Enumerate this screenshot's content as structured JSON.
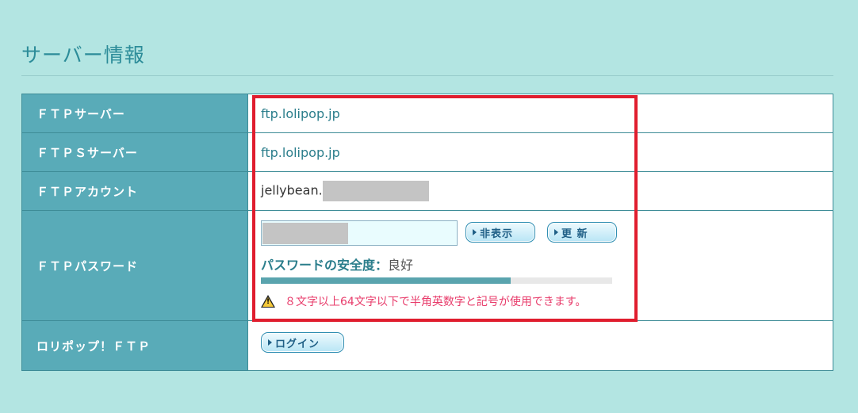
{
  "page": {
    "title": "サーバー情報"
  },
  "rows": {
    "ftp_server": {
      "label": "ＦＴＰサーバー",
      "value": "ftp.lolipop.jp"
    },
    "ftps_server": {
      "label": "ＦＴＰＳサーバー",
      "value": "ftp.lolipop.jp"
    },
    "ftp_account": {
      "label": "ＦＴＰアカウント",
      "value_prefix": "jellybean."
    },
    "ftp_password": {
      "label": "ＦＴＰパスワード",
      "hide_button": "非表示",
      "update_button": "更 新",
      "strength_label": "パスワードの安全度：",
      "strength_value": "良好",
      "strength_level": 0.71,
      "warning": "８文字以上64文字以下で半角英数字と記号が使用できます。"
    },
    "lolipop_ftp": {
      "label": "ロリポップ！ＦＴＰ",
      "login_button": "ログイン"
    }
  },
  "colors": {
    "background": "#b3e5e2",
    "header_cell": "#59abb8",
    "accent_text": "#2a7d8b",
    "warning_text": "#e83c6b",
    "highlight_border": "#e01d2e"
  }
}
